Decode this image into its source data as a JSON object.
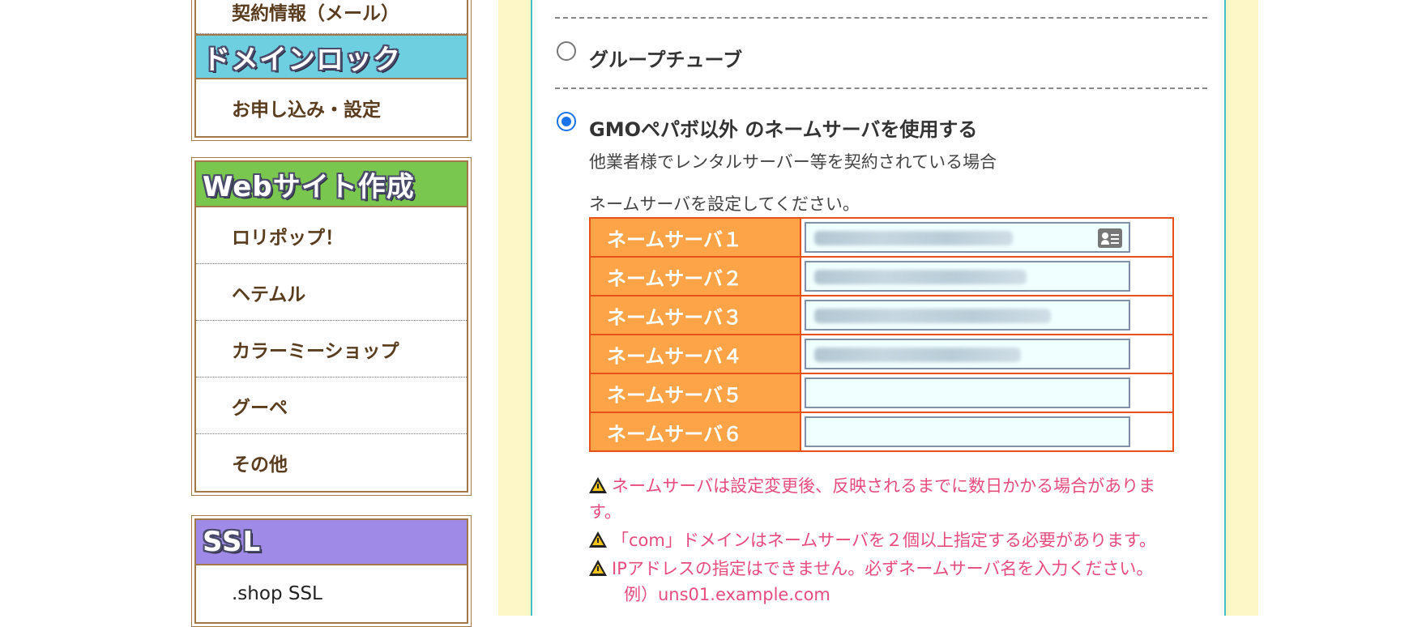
{
  "sidebar": {
    "box1": {
      "top_item": "契約情報（メール）",
      "header": "ドメインロック",
      "header_color": "#6dcfe0",
      "items": [
        "お申し込み・設定"
      ]
    },
    "box2": {
      "header": "Webサイト作成",
      "header_color": "#7ac74f",
      "items": [
        "ロリポップ！",
        "ヘテムル",
        "カラーミーショップ",
        "グーペ",
        "その他"
      ]
    },
    "box3": {
      "header": "SSL",
      "header_color": "#a08ae8",
      "items": [
        ".shop SSL"
      ]
    }
  },
  "options": {
    "group_tube": {
      "label": "グループチューブ",
      "selected": false
    },
    "other": {
      "label": "GMOペパボ以外 のネームサーバを使用する",
      "selected": true,
      "description": "他業者様でレンタルサーバー等を契約されている場合"
    }
  },
  "nameserver": {
    "instruction": "ネームサーバを設定してください。",
    "rows": [
      {
        "label": "ネームサーバ１",
        "has_value": true
      },
      {
        "label": "ネームサーバ２",
        "has_value": true
      },
      {
        "label": "ネームサーバ３",
        "has_value": true
      },
      {
        "label": "ネームサーバ４",
        "has_value": true
      },
      {
        "label": "ネームサーバ５",
        "has_value": false
      },
      {
        "label": "ネームサーバ６",
        "has_value": false
      }
    ]
  },
  "warnings": {
    "w1": "ネームサーバは設定変更後、反映されるまでに数日かかる場合がありま",
    "w1_cont": "す。",
    "w2": "「com」ドメインはネームサーバを２個以上指定する必要があります。",
    "w3": "IPアドレスの指定はできません。必ずネームサーバ名を入力ください。",
    "w3_example": "例）uns01.example.com"
  },
  "colors": {
    "accent_radio": "#1a73e8",
    "table_label_bg": "#fca447",
    "table_border": "#e8521a",
    "warning_text": "#e84c7d",
    "panel_border": "#40c0c8",
    "band_bg": "#fdf6c6"
  }
}
